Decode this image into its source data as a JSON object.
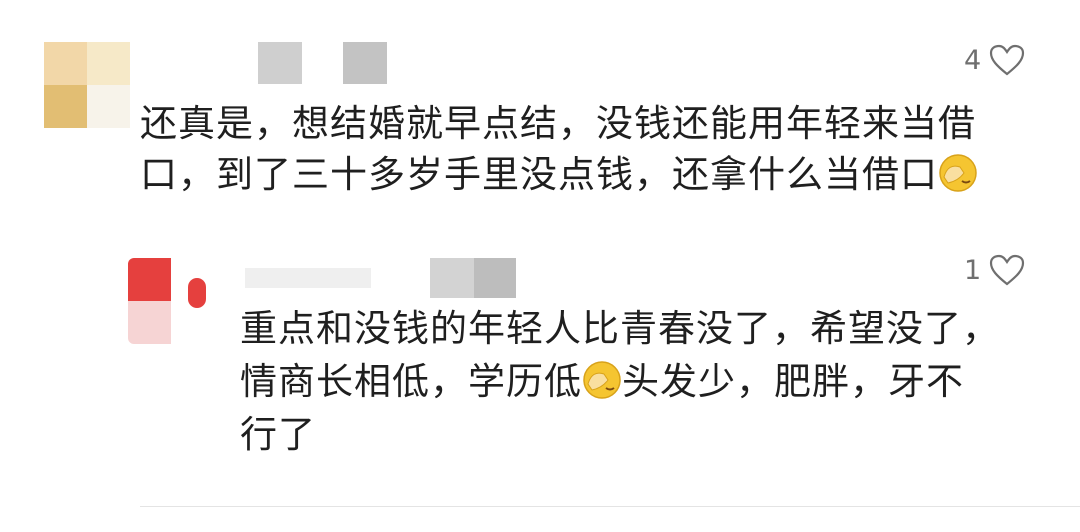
{
  "comments": [
    {
      "text_lines": [
        "还真是，想结婚就早点结，没钱还能用年轻来当借",
        "口，到了三十多岁手里没点钱，还拿什么当借口"
      ],
      "likes": "4"
    },
    {
      "text_lines": [
        "重点和没钱的年轻人比青春没了，希望没了，",
        "情商长相低，学历低",
        "头发少，肥胖，牙不",
        "行了"
      ],
      "likes": "1"
    }
  ],
  "icons": {
    "like": "heart-outline-icon",
    "emoji": "facepalm-emoji-icon"
  },
  "colors": {
    "text": "#1f1f1f",
    "meta": "#6f6f6f",
    "avatar1": [
      "#f2d7a8",
      "#f6e9c8",
      "#e2be73",
      "#f7f3ea"
    ],
    "avatar2": [
      "#e5403e",
      "#ffffff",
      "#f6d4d4",
      "#ffffff"
    ]
  }
}
